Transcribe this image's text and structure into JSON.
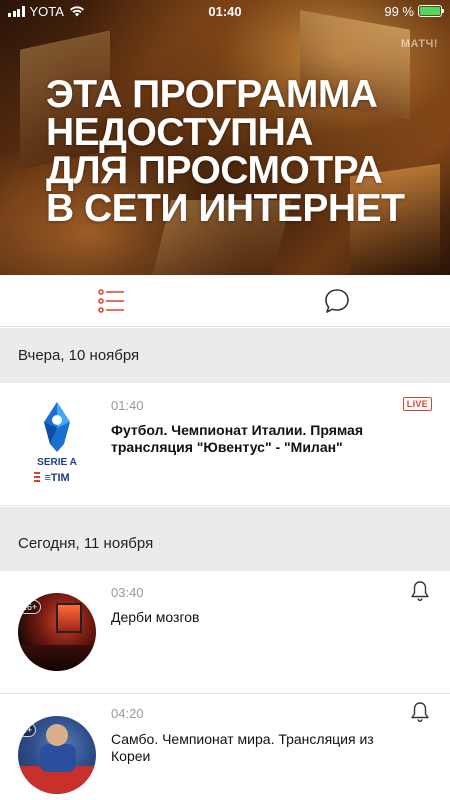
{
  "status_bar": {
    "carrier": "YOTA",
    "time": "01:40",
    "battery": "99 %",
    "battery_level": 0.99
  },
  "hero": {
    "logo": "МАТЧ!",
    "message_lines": [
      "ЭТА ПРОГРАММА",
      "НЕДОСТУПНА",
      "ДЛЯ ПРОСМОТРА",
      "В СЕТИ ИНТЕРНЕТ"
    ]
  },
  "toolbar": {
    "list_icon": "list-icon",
    "chat_icon": "chat-bubble-icon",
    "accent_color": "#e0402a"
  },
  "schedule": {
    "sections": [
      {
        "date": "Вчера, 10 ноября",
        "items": [
          {
            "time": "01:40",
            "title": "Футбол. Чемпионат Италии. Прямая трансляция \"Ювентус\" - \"Милан\"",
            "badge": "LIVE",
            "thumb": "Serie A TIM logo"
          }
        ]
      },
      {
        "date": "Сегодня, 11 ноября",
        "items": [
          {
            "time": "03:40",
            "title": "Дерби мозгов",
            "age": "16+",
            "thumb": "studio"
          },
          {
            "time": "04:20",
            "title": "Самбо. Чемпионат мира. Трансляция из Кореи",
            "age": "0+",
            "thumb": "sambo"
          }
        ]
      }
    ]
  }
}
